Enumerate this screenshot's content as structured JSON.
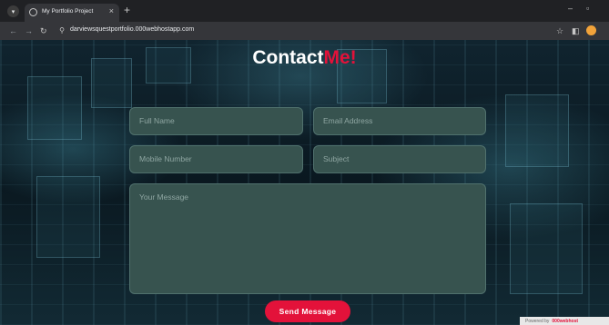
{
  "browser": {
    "tab_title": "My Portfolio Project",
    "url": "darviewsquestportfolio.000webhostapp.com"
  },
  "page": {
    "heading_main": "Contact",
    "heading_accent": "Me!",
    "accent_color": "#e3123a",
    "fields": {
      "full_name_placeholder": "Full Name",
      "email_placeholder": "Email Address",
      "mobile_placeholder": "Mobile Number",
      "subject_placeholder": "Subject",
      "message_placeholder": "Your Message"
    },
    "send_label": "Send Message",
    "badge_prefix": "Powered by",
    "badge_brand": "000webhost"
  }
}
